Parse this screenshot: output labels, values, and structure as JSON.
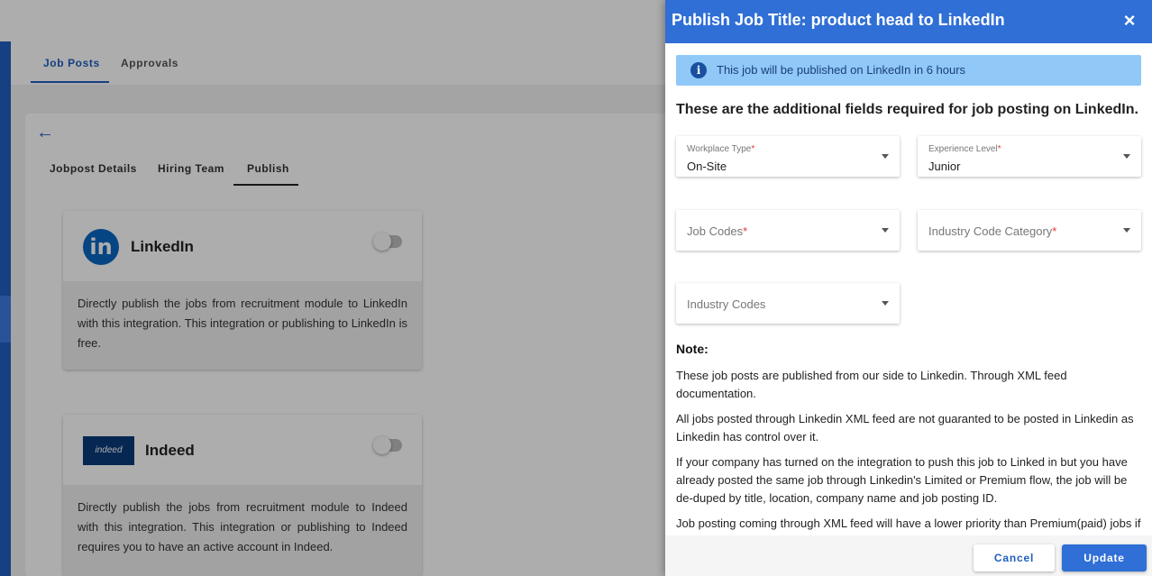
{
  "background": {
    "main_tabs": [
      {
        "label": "Job Posts",
        "active": true
      },
      {
        "label": "Approvals",
        "active": false
      }
    ],
    "sub_tabs": [
      {
        "label": "Jobpost Details"
      },
      {
        "label": "Hiring Team"
      },
      {
        "label": "Publish",
        "active": true
      }
    ],
    "integrations": [
      {
        "name": "LinkedIn",
        "logo_text": "in",
        "description": "Directly publish the jobs from recruitment module to LinkedIn with this integration. This integration or publishing to LinkedIn is free.",
        "enabled": false
      },
      {
        "name": "Indeed",
        "logo_text": "indeed",
        "description": "Directly publish the jobs from recruitment module to Indeed with this integration. This integration or publishing to Indeed requires you to have an active account in Indeed.",
        "enabled": false
      }
    ]
  },
  "drawer": {
    "title": "Publish Job Title: product head to LinkedIn",
    "close_icon": "×",
    "info_icon": "i",
    "info": "This job will be published on LinkedIn in 6 hours",
    "heading": "These are the additional fields required for job posting on LinkedIn.",
    "fields": {
      "workplace_type": {
        "label": "Workplace Type",
        "value": "On-Site",
        "required": "*"
      },
      "experience_level": {
        "label": "Experience Level",
        "value": "Junior",
        "required": "*"
      },
      "job_codes": {
        "placeholder": "Job Codes",
        "required": "*"
      },
      "industry_code_category": {
        "placeholder": "Industry Code Category",
        "required": "*"
      },
      "industry_codes": {
        "placeholder": "Industry Codes"
      }
    },
    "note_heading": "Note:",
    "notes": [
      "These job posts are published from our side to Linkedin. Through XML feed documentation.",
      "All jobs posted through Linkedin XML feed are not guaranted to be posted in Linkedin as Linkedin has control over it.",
      "If your company has turned on the integration to push this job to Linked in but you have already posted the same job through Linkedin's Limited or Premium flow, the job will be de-duped by title, location, company name and job posting ID.",
      "Job posting coming through XML feed will have a lower priority than Premium(paid) jobs if"
    ],
    "cancel_label": "Cancel",
    "update_label": "Update"
  },
  "colors": {
    "primary": "#2f6fd6",
    "info_bg": "#90c8f8",
    "required": "#e53935"
  }
}
